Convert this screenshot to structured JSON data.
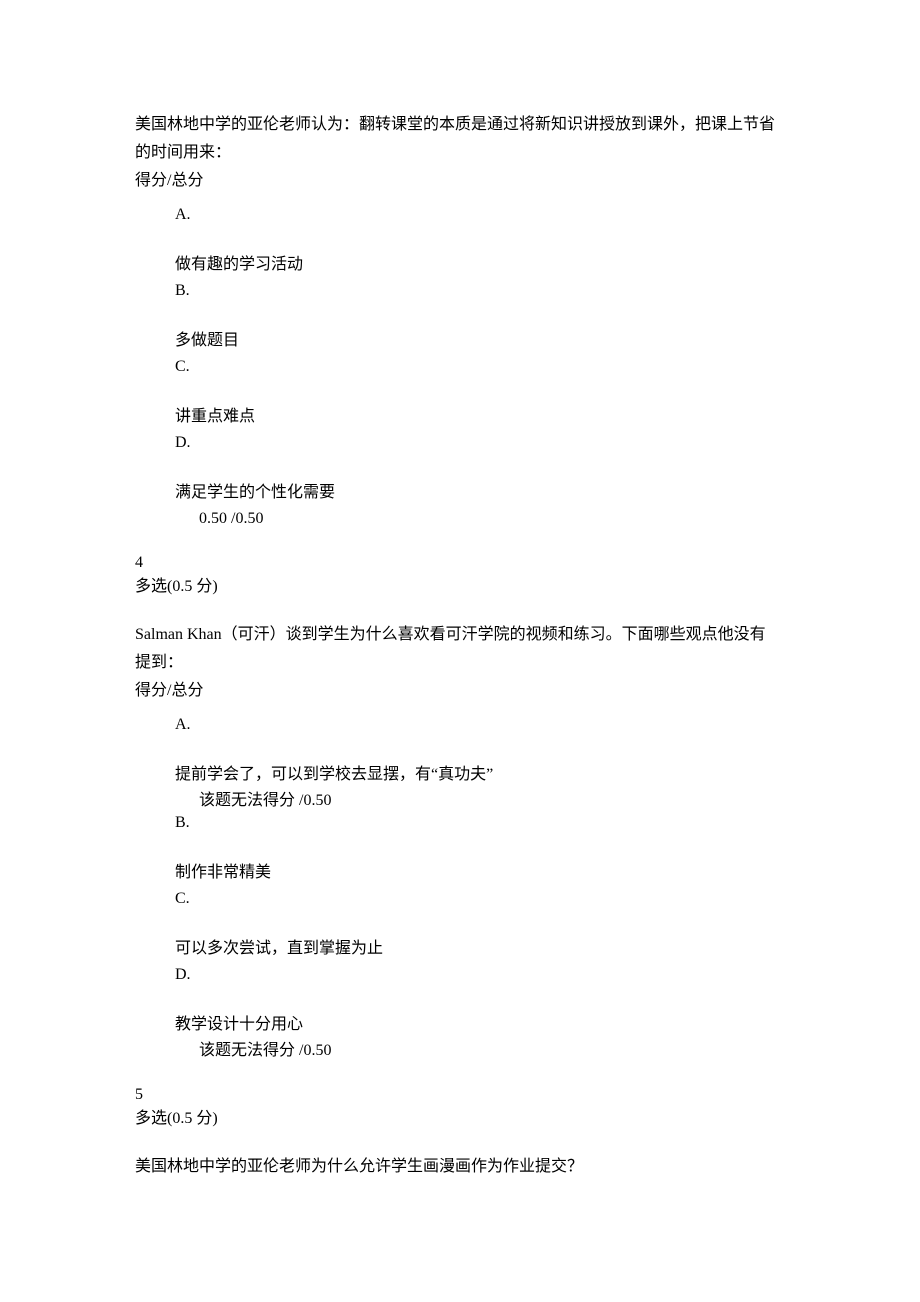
{
  "q3": {
    "stem_line1": "美国林地中学的亚伦老师认为：翻转课堂的本质是通过将新知识讲授放到课外，把课上节省",
    "stem_line2": "的时间用来：",
    "score_label": "得分/总分",
    "A_letter": "A.",
    "A_text": "做有趣的学习活动",
    "B_letter": "B.",
    "B_text": "多做题目",
    "C_letter": "C.",
    "C_text": "讲重点难点",
    "D_letter": "D.",
    "D_text": "满足学生的个性化需要",
    "score_line": "0.50 /0.50"
  },
  "q4": {
    "number": "4",
    "type": "多选(0.5 分)",
    "stem_line1": "Salman Khan（可汗）谈到学生为什么喜欢看可汗学院的视频和练习。下面哪些观点他没有",
    "stem_line2": "提到：",
    "score_label": "得分/总分",
    "A_letter": "A.",
    "A_text": "提前学会了，可以到学校去显摆，有“真功夫”",
    "A_score": "该题无法得分  /0.50",
    "B_letter": "B.",
    "B_text": "制作非常精美",
    "C_letter": "C.",
    "C_text": "可以多次尝试，直到掌握为止",
    "D_letter": "D.",
    "D_text": "教学设计十分用心",
    "D_score": "该题无法得分  /0.50"
  },
  "q5": {
    "number": "5",
    "type": "多选(0.5 分)",
    "stem": "美国林地中学的亚伦老师为什么允许学生画漫画作为作业提交？"
  }
}
